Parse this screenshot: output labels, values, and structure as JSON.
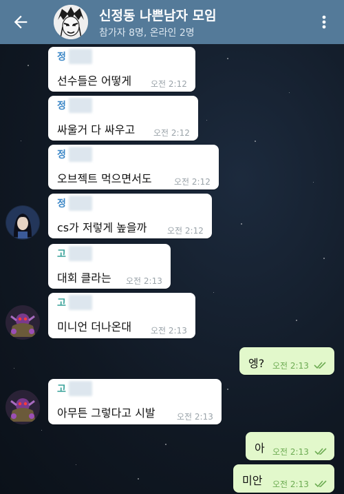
{
  "header": {
    "title": "신정동 나쁜남자 모임",
    "subtitle": "참가자 8명, 온라인 2명"
  },
  "messages": [
    {
      "sender": "정",
      "text": "선수들은 어떻게",
      "time": "오전 2:12"
    },
    {
      "sender": "정",
      "text": "싸울거 다 싸우고",
      "time": "오전 2:12"
    },
    {
      "sender": "정",
      "text": "오브젝트 먹으면서도",
      "time": "오전 2:12"
    },
    {
      "sender": "정",
      "text": "cs가 저렇게 높을까",
      "time": "오전 2:12"
    },
    {
      "sender": "고",
      "text": "대회 클라는",
      "time": "오전 2:13"
    },
    {
      "sender": "고",
      "text": "미니언 더나온대",
      "time": "오전 2:13"
    },
    {
      "sender": "",
      "text": "엥?",
      "time": "오전 2:13"
    },
    {
      "sender": "고",
      "text": "아무튼 그렇다고 시발",
      "time": "오전 2:13"
    },
    {
      "sender": "",
      "text": "아",
      "time": "오전 2:13"
    },
    {
      "sender": "",
      "text": "미안",
      "time": "오전 2:13"
    }
  ],
  "colors": {
    "header_bg": "#547a99",
    "sender_jung": "#3a86c6",
    "sender_go": "#3aa39a",
    "outgoing_bubble": "#e2f8cb",
    "incoming_bubble": "#ffffff"
  },
  "icons": {
    "back": "arrow-left-icon",
    "more": "more-vertical-icon",
    "read": "double-check-icon"
  }
}
